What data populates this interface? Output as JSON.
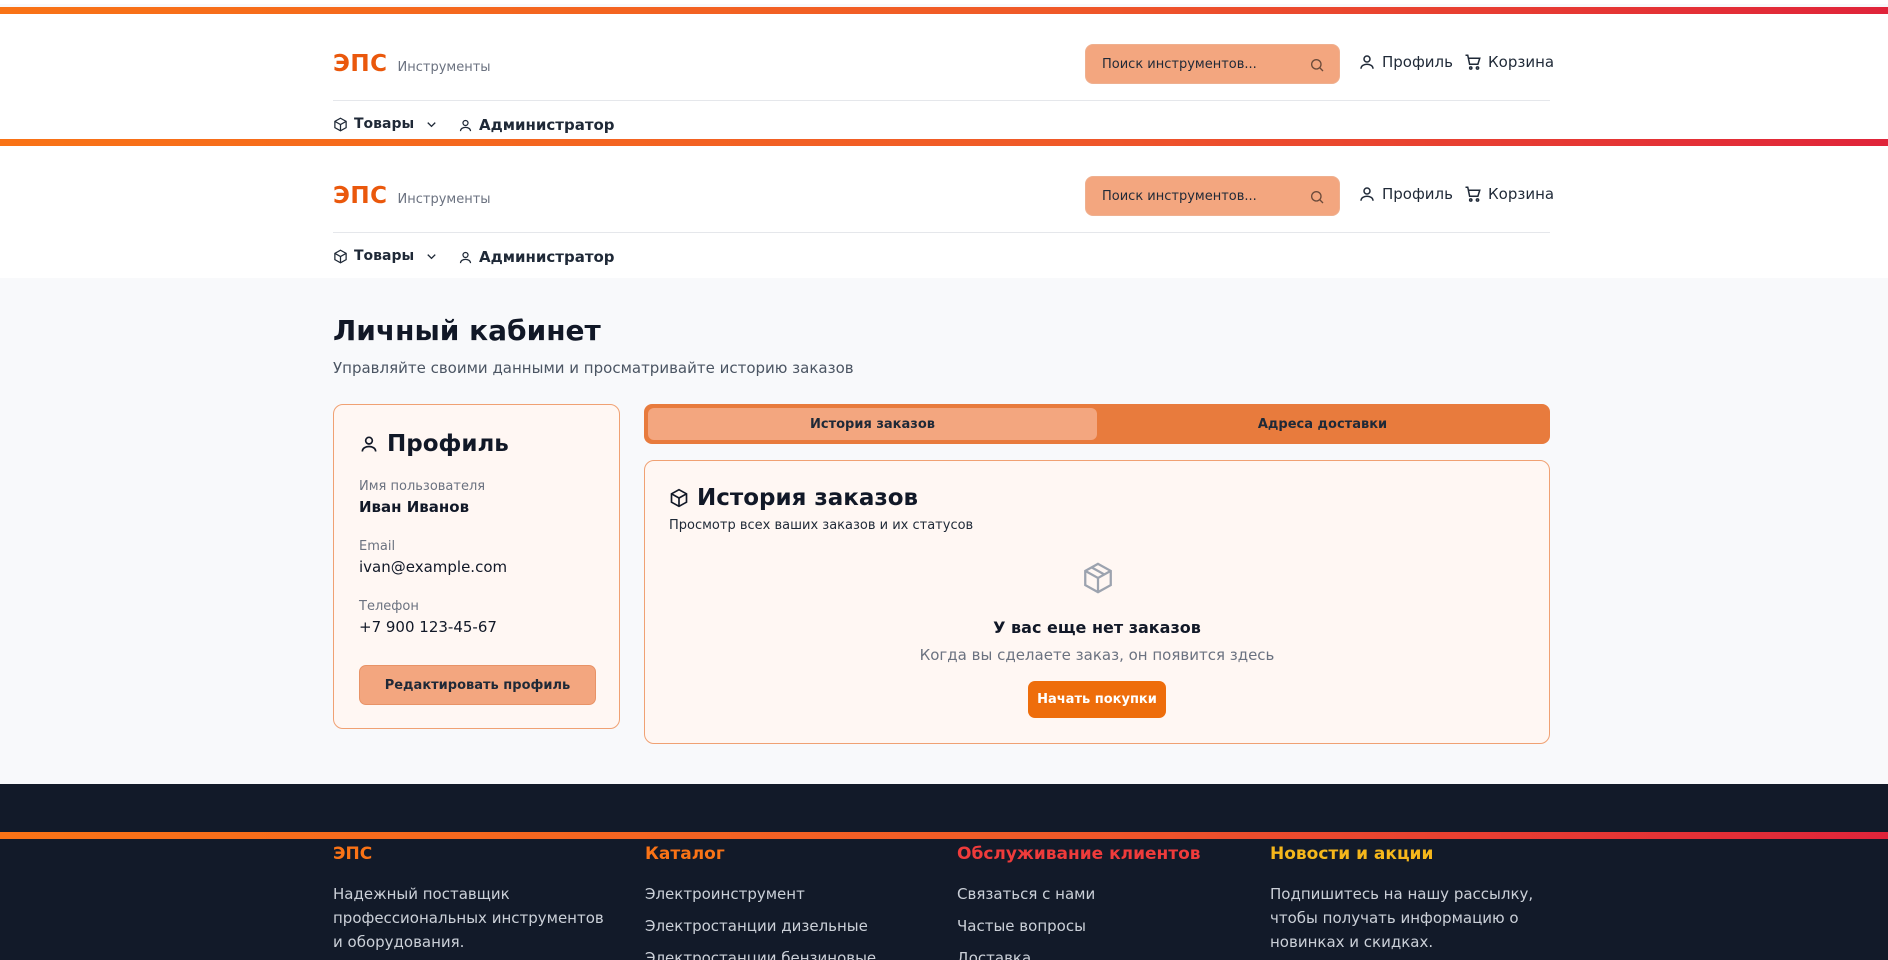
{
  "colors": {
    "accent": "#ea580c",
    "gradient_start": "#f97316",
    "gradient_end": "#e0243a",
    "footer_bg": "#121a29"
  },
  "header": {
    "brand": "ЭПС",
    "brand_sub": "Инструменты",
    "search_placeholder": "Поиск инструментов...",
    "profile_label": "Профиль",
    "cart_label": "Корзина",
    "nav_products": "Товары",
    "nav_admin": "Администратор"
  },
  "page": {
    "title": "Личный кабинет",
    "subtitle": "Управляйте своими данными и просматривайте историю заказов"
  },
  "profile": {
    "title": "Профиль",
    "fields": [
      {
        "label": "Имя пользователя",
        "value": "Иван Иванов"
      },
      {
        "label": "Email",
        "value": "ivan@example.com"
      },
      {
        "label": "Телефон",
        "value": "+7 900 123-45-67"
      }
    ],
    "edit_button": "Редактировать профиль"
  },
  "tabs": [
    {
      "label": "История заказов",
      "active": true
    },
    {
      "label": "Адреса доставки",
      "active": false
    }
  ],
  "orders": {
    "title": "История заказов",
    "subtitle": "Просмотр всех ваших заказов и их статусов",
    "empty_title": "У вас еще нет заказов",
    "empty_text": "Когда вы сделаете заказ, он появится здесь",
    "start_button": "Начать покупки"
  },
  "footer": {
    "about": {
      "heading": "ЭПС",
      "text": "Надежный поставщик профессиональных инструментов и оборудования.",
      "color": "#f97316"
    },
    "catalog": {
      "heading": "Каталог",
      "items": [
        "Электроинструмент",
        "Электростанции дизельные",
        "Электростанции бензиновые"
      ],
      "color": "#f97316"
    },
    "service": {
      "heading": "Обслуживание клиентов",
      "items": [
        "Связаться с нами",
        "Частые вопросы",
        "Доставка"
      ],
      "color": "#ef3b3b"
    },
    "news": {
      "heading": "Новости и акции",
      "text": "Подпишитесь на нашу рассылку, чтобы получать информацию о новинках и скидках.",
      "color": "#f5b71b"
    }
  }
}
